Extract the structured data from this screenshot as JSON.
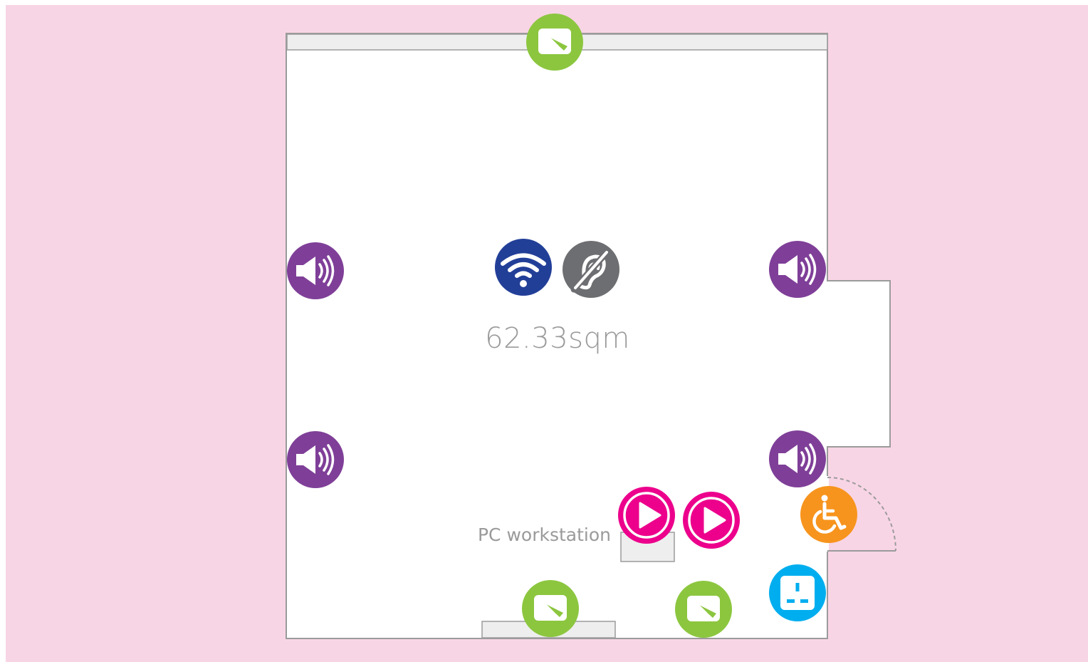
{
  "floor_plan": {
    "area_label": "62.33sqm",
    "pc_workstation_label": "PC workstation"
  },
  "colors": {
    "background": "#f8d5e5",
    "room_fill": "#ffffff",
    "wall_stroke": "#9b9b9b",
    "fixture_fill": "#eeeeee",
    "whiteboard_green": "#8cc63f",
    "speaker_purple": "#7f3f98",
    "wifi_blue": "#223f98",
    "hearing_loop_grey": "#6d6e71",
    "play_magenta": "#ec008c",
    "accessible_orange": "#f7941d",
    "power_socket_blue": "#00aeef"
  },
  "icons": {
    "whiteboard": "whiteboard-icon",
    "speaker": "speaker-icon",
    "wifi": "wifi-icon",
    "hearing_loop": "hearing-loop-icon",
    "play": "play-icon",
    "wheelchair": "wheelchair-icon",
    "power_socket": "power-socket-icon"
  }
}
